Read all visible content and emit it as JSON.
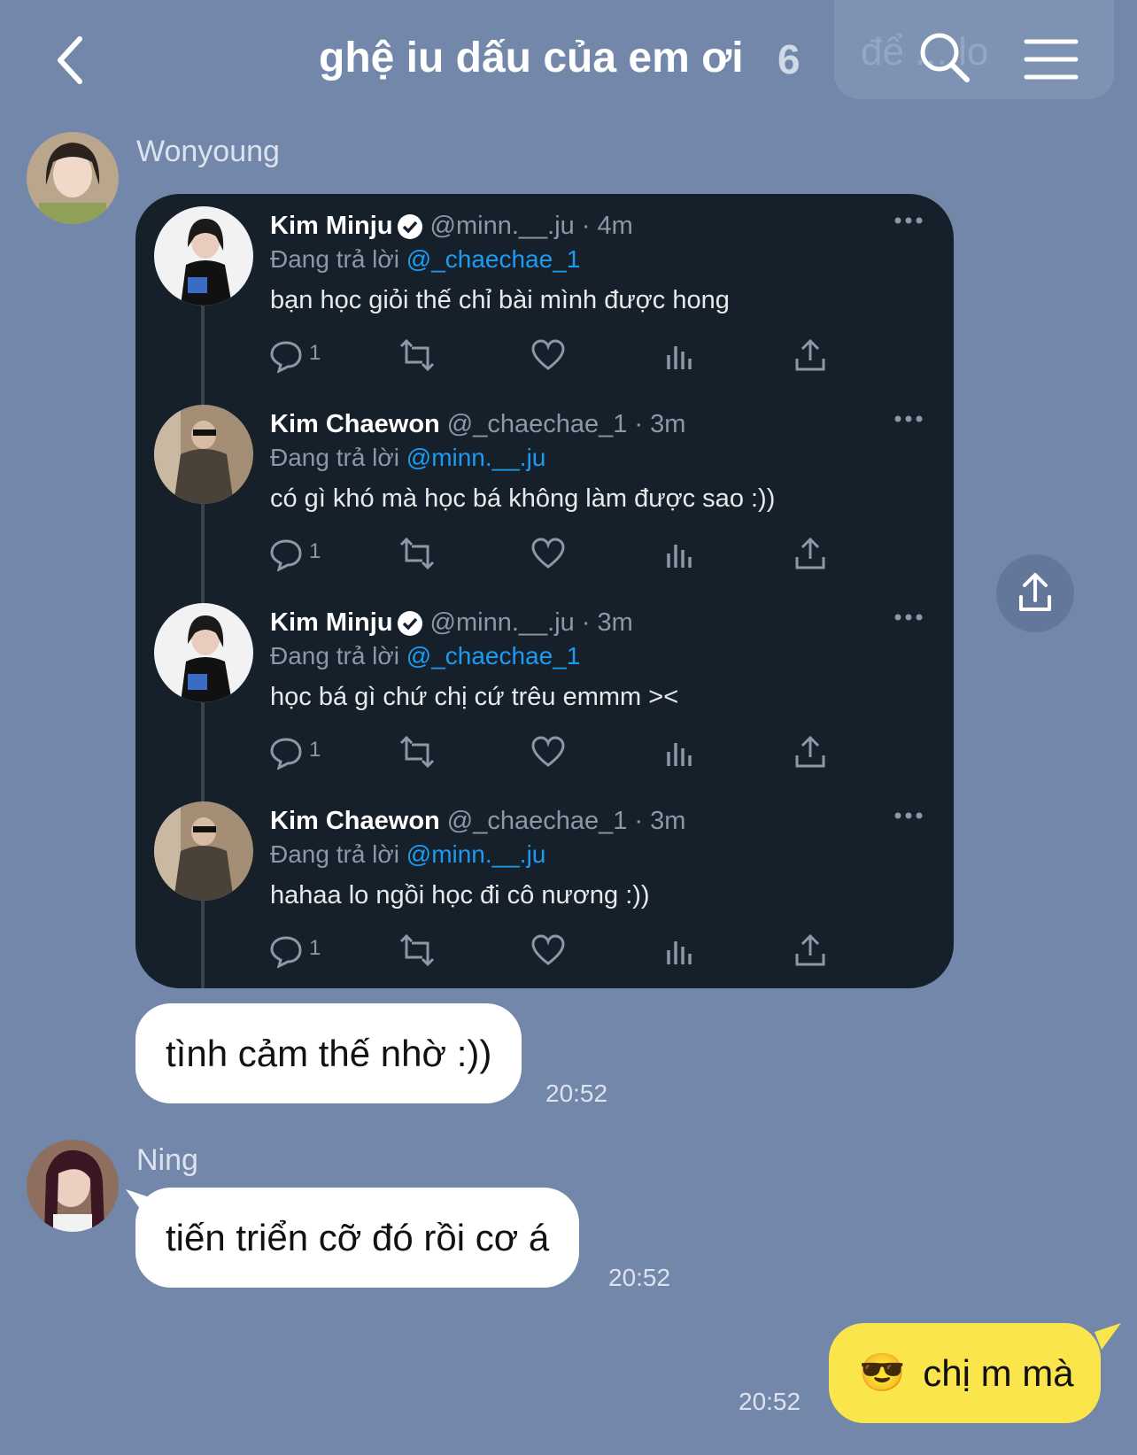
{
  "header": {
    "title": "ghệ iu dấu của em ơi",
    "member_count": "6",
    "faded_preview": "để ... lo"
  },
  "messages": {
    "m1": {
      "sender": "Wonyoung"
    },
    "m2": {
      "text": "tình cảm thế nhờ :))",
      "time": "20:52"
    },
    "m3": {
      "sender": "Ning",
      "text": "tiến triển cỡ đó rồi cơ á",
      "time": "20:52"
    },
    "m4": {
      "emoji": "😎",
      "text": "chị m mà",
      "time": "20:52"
    }
  },
  "tweets": [
    {
      "name": "Kim Minju",
      "verified": true,
      "handle": "@minn.__.ju · 4m",
      "reply_prefix": "Đang trả lời ",
      "mention": "@_chaechae_1",
      "body": "bạn học giỏi thế chỉ bài mình được hong",
      "reply_count": "1"
    },
    {
      "name": "Kim Chaewon",
      "verified": false,
      "handle": "@_chaechae_1 · 3m",
      "reply_prefix": "Đang trả lời ",
      "mention": "@minn.__.ju",
      "body": "có gì khó mà học bá không làm được sao :))",
      "reply_count": "1"
    },
    {
      "name": "Kim Minju",
      "verified": true,
      "handle": "@minn.__.ju · 3m",
      "reply_prefix": "Đang trả lời ",
      "mention": "@_chaechae_1",
      "body": "học bá gì chứ chị cứ trêu emmm ><",
      "reply_count": "1"
    },
    {
      "name": "Kim Chaewon",
      "verified": false,
      "handle": "@_chaechae_1 · 3m",
      "reply_prefix": "Đang trả lời ",
      "mention": "@minn.__.ju",
      "body": "hahaa lo ngồi học đi cô nương :))",
      "reply_count": "1"
    }
  ],
  "colors": {
    "chat_background": "#7287AA",
    "my_bubble": "#FAE64C",
    "tweet_background": "#15202B",
    "mention_blue": "#1D9BF0"
  },
  "icons": [
    "back-arrow-icon",
    "search-icon",
    "menu-icon",
    "share-icon",
    "reply-icon",
    "retweet-icon",
    "like-icon",
    "views-icon",
    "verified-icon",
    "more-icon"
  ]
}
